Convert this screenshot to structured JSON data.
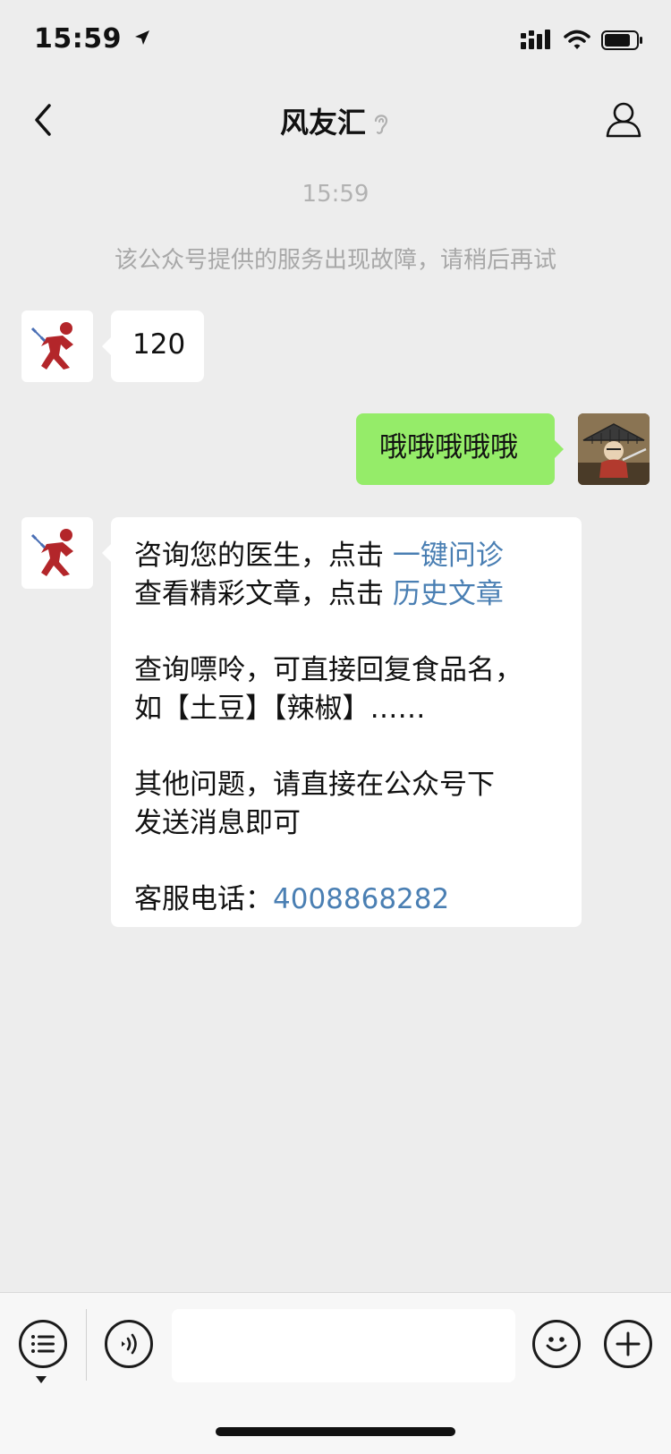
{
  "status_bar": {
    "time": "15:59"
  },
  "nav": {
    "title": "风友汇"
  },
  "chat": {
    "timestamp": "15:59",
    "notice": "该公众号提供的服务出现故障，请稍后再试",
    "messages": {
      "m1": {
        "text": "120"
      },
      "m2": {
        "text": "哦哦哦哦哦"
      },
      "m3": {
        "line1_text": "咨询您的医生，点击 ",
        "line1_link": "一键问诊",
        "line2_text": "查看精彩文章，点击 ",
        "line2_link": "历史文章",
        "line3": "查询嘌呤，可直接回复食品名，",
        "line4": "如【土豆】【辣椒】……",
        "line5": "其他问题，请直接在公众号下",
        "line6": "发送消息即可",
        "phone_label": "客服电话：",
        "phone_number": "4008868282"
      }
    }
  },
  "icons": {
    "location": "location-arrow-icon",
    "signal": "signal-icon",
    "wifi": "wifi-icon",
    "battery": "battery-icon",
    "back": "chevron-left-icon",
    "ear": "ear-icon",
    "profile": "person-icon",
    "menu": "menu-list-icon",
    "voice": "voice-icon",
    "emoji": "emoji-icon",
    "add": "plus-icon"
  },
  "colors": {
    "background": "#ededed",
    "bubble_self": "#95ec69",
    "bubble_other": "#ffffff",
    "link": "#4a7fb3"
  }
}
